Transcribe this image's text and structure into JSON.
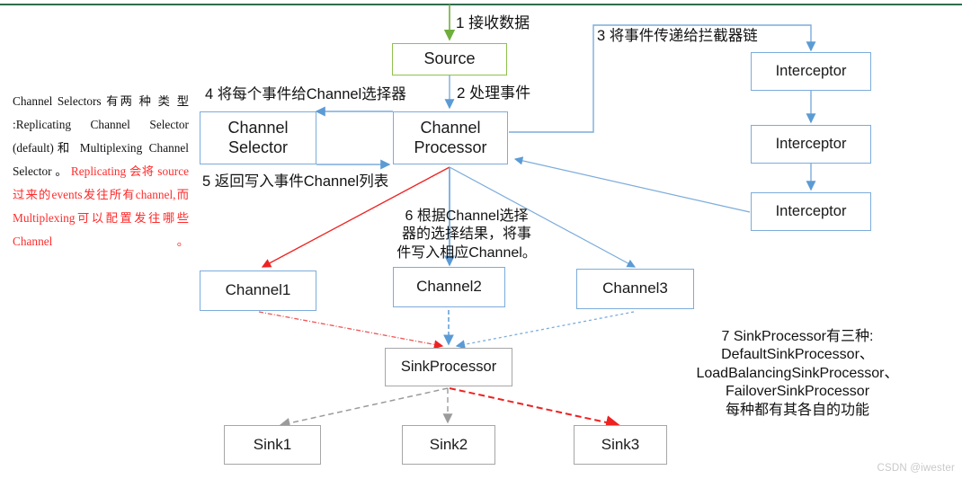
{
  "diagram": {
    "title": "Flume Source / Channel / Sink data flow",
    "top_rule_color": "#2e6e4e",
    "note": {
      "black_part": "    Channel  Selectors 有两 种 类 型 :Replicating Channel Selector (default)和 Multiplexing            Channel Selector 。 ",
      "red_part": "Replicating 会将 source过来的events发往所有channel,而 Multiplexing可以配置发往哪些Channel。",
      "red_color": "#ff2b2b"
    },
    "nodes": {
      "source": "Source",
      "channel_selector": "Channel\nSelector",
      "channel_processor": "Channel\nProcessor",
      "interceptor1": "Interceptor",
      "interceptor2": "Interceptor",
      "interceptor3": "Interceptor",
      "channel1": "Channel1",
      "channel2": "Channel2",
      "channel3": "Channel3",
      "sink_processor": "SinkProcessor",
      "sink1": "Sink1",
      "sink2": "Sink2",
      "sink3": "Sink3"
    },
    "steps": {
      "s1": "1 接收数据",
      "s2": "2 处理事件",
      "s3": "3 将事件传递给拦截器链",
      "s4": "4 将每个事件给Channel选择器",
      "s5": "5 返回写入事件Channel列表",
      "s6": "6 根据Channel选择\n器的选择结果，将事\n件写入相应Channel。",
      "s7": "7 SinkProcessor有三种:\nDefaultSinkProcessor、\nLoadBalancingSinkProcessor、\nFailoverSinkProcessor\n每种都有其各自的功能"
    },
    "colors": {
      "blue_edge": "#7cacdb",
      "green_edge": "#8ec14c",
      "gray_edge": "#a6a6a6",
      "red_edge": "#ee2222",
      "text": "#121212"
    },
    "watermark": "CSDN @iwester"
  }
}
